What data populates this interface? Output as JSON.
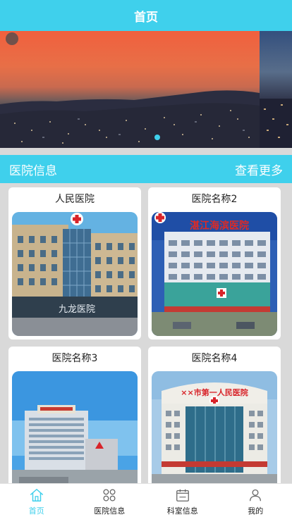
{
  "header": {
    "title": "首页"
  },
  "banner": {
    "slide_count": 2,
    "active_index": 1,
    "accent_color": "#3fd0ec"
  },
  "section": {
    "title": "医院信息",
    "more_label": "查看更多"
  },
  "hospitals": [
    {
      "name": "人民医院",
      "image": "hospital-building-photo",
      "sign_text": "九龙医院"
    },
    {
      "name": "医院名称2",
      "image": "hospital-building-photo",
      "sign_text": "湛江海滨医院"
    },
    {
      "name": "医院名称3",
      "image": "hospital-building-photo"
    },
    {
      "name": "医院名称4",
      "image": "hospital-building-photo",
      "sign_text": "××市第一人民医院"
    }
  ],
  "tabbar": {
    "items": [
      {
        "label": "首页",
        "icon": "home-icon",
        "active": true
      },
      {
        "label": "医院信息",
        "icon": "grid-icon",
        "active": false
      },
      {
        "label": "科室信息",
        "icon": "calendar-icon",
        "active": false
      },
      {
        "label": "我的",
        "icon": "user-icon",
        "active": false
      }
    ],
    "active_color": "#3fd0ec"
  }
}
